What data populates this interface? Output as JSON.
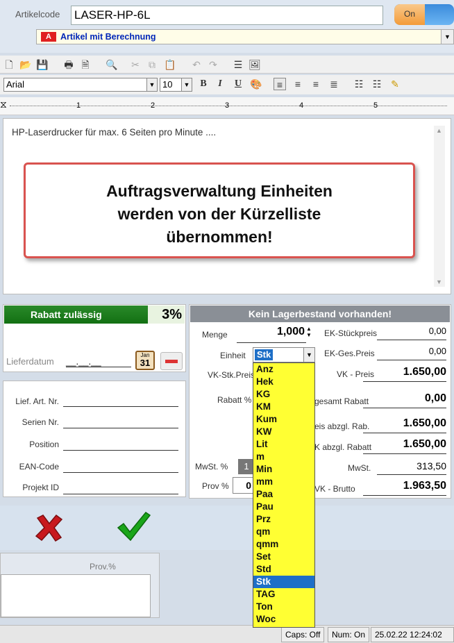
{
  "header": {
    "code_label": "Artikelcode",
    "code_value": "LASER-HP-6L",
    "toggle_label": "On",
    "category_badge": "A",
    "category_text": "Artikel mit Berechnung"
  },
  "toolbar": {
    "font": "Arial",
    "size": "10",
    "bold_label": "B",
    "italic_label": "I",
    "underline_label": "U"
  },
  "ruler": {
    "marks": [
      "1",
      "2",
      "3",
      "4",
      "5"
    ]
  },
  "editor": {
    "text": "HP-Laserdrucker  für max. 6 Seiten pro Minute ....",
    "callout_line1": "Auftragsverwaltung Einheiten",
    "callout_line2": "werden von der Kürzelliste",
    "callout_line3": "übernommen!"
  },
  "discount": {
    "label": "Rabatt zulässig",
    "percent": "3%"
  },
  "delivery": {
    "label": "Lieferdatum",
    "value": "__.__.__",
    "calendar_day": "31",
    "calendar_month": "Jan"
  },
  "fields": {
    "lief_art": "Lief. Art. Nr.",
    "serien": "Serien Nr.",
    "position": "Position",
    "ean": "EAN-Code",
    "projekt": "Projekt ID"
  },
  "stock": {
    "header": "Kein Lagerbestand vorhanden!",
    "menge_label": "Menge",
    "menge_value": "1,000",
    "einheit_label": "Einheit",
    "einheit_value": "Stk",
    "vk_stk_label": "VK-Stk.Preis",
    "rabatt_label": "Rabatt %",
    "mwst_label": "MwSt. %",
    "mwst_badge": "1",
    "prov_label": "Prov %",
    "prov_value": "0"
  },
  "prices": {
    "ek_stk_label": "EK-Stückpreis",
    "ek_stk": "0,00",
    "ek_ges_label": "EK-Ges.Preis",
    "ek_ges": "0,00",
    "vk_label": "VK - Preis",
    "vk": "1.650,00",
    "ges_rabatt_label": "gesamt Rabatt",
    "ges_rabatt": "0,00",
    "abzgl_label": "eis abzgl. Rab.",
    "abzgl": "1.650,00",
    "vk_abzgl_label": "K abzgl. Rabatt",
    "vk_abzgl": "1.650,00",
    "mwst_label": "MwSt.",
    "mwst": "313,50",
    "brutto_label": "VK - Brutto",
    "brutto": "1.963,50"
  },
  "units": [
    "Anz",
    "Hek",
    "KG",
    "KM",
    "Kum",
    "KW",
    "Lit",
    "m",
    "Min",
    "mm",
    "Paa",
    "Pau",
    "Prz",
    "qm",
    "qmm",
    "Set",
    "Std",
    "Stk",
    "TAG",
    "Ton",
    "Woc"
  ],
  "selected_unit": "Stk",
  "provision": {
    "header": "Prov.%"
  },
  "status": {
    "caps": "Caps: Off",
    "num": "Num: On",
    "datetime": "25.02.22 12:24:02"
  },
  "colors": {
    "accent_green": "#127012",
    "callout_border": "#d9534f",
    "dropdown_bg": "#ffff33",
    "selection": "#1e6fc7"
  }
}
